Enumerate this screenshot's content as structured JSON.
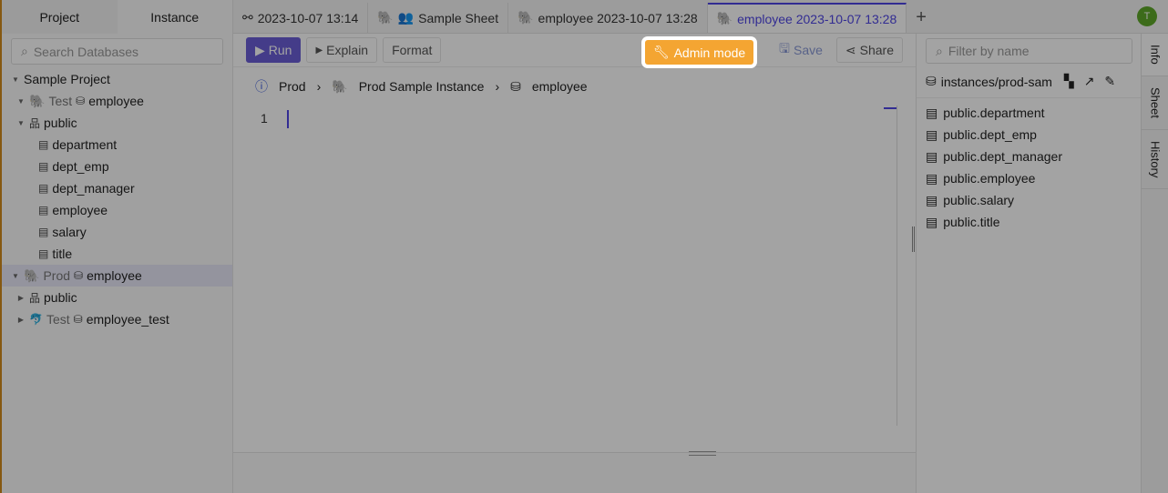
{
  "sidebar": {
    "tabs": [
      "Project",
      "Instance"
    ],
    "search_placeholder": "Search Databases",
    "tree": {
      "project": "Sample Project",
      "test_env": "Test",
      "test_db": "employee",
      "schema": "public",
      "tables": [
        "department",
        "dept_emp",
        "dept_manager",
        "employee",
        "salary",
        "title"
      ],
      "prod_env": "Prod",
      "prod_db": "employee",
      "prod_schema": "public",
      "test2_env": "Test",
      "test2_db": "employee_test"
    }
  },
  "tabs": [
    {
      "label": "2023-10-07 13:14",
      "icon": "unlink-icon"
    },
    {
      "label": "Sample Sheet",
      "icon": "postgres-icon"
    },
    {
      "label": "employee 2023-10-07 13:28",
      "icon": "postgres-icon"
    },
    {
      "label": "employee 2023-10-07 13:28",
      "icon": "postgres-icon",
      "active": true
    }
  ],
  "user": {
    "avatar": "T"
  },
  "toolbar": {
    "run": "Run",
    "explain": "Explain",
    "format": "Format",
    "admin": "Admin mode",
    "save": "Save",
    "share": "Share"
  },
  "breadcrumb": {
    "env": "Prod",
    "instance": "Prod Sample Instance",
    "database": "employee"
  },
  "editor": {
    "line": "1"
  },
  "right": {
    "filter_placeholder": "Filter by name",
    "instance": "instances/prod-sam",
    "tables": [
      "public.department",
      "public.dept_emp",
      "public.dept_manager",
      "public.employee",
      "public.salary",
      "public.title"
    ]
  },
  "vtabs": [
    "Info",
    "Sheet",
    "History"
  ],
  "colors": {
    "accent": "#4f46e5",
    "admin": "#f4a532",
    "run": "#6b5fd6"
  }
}
